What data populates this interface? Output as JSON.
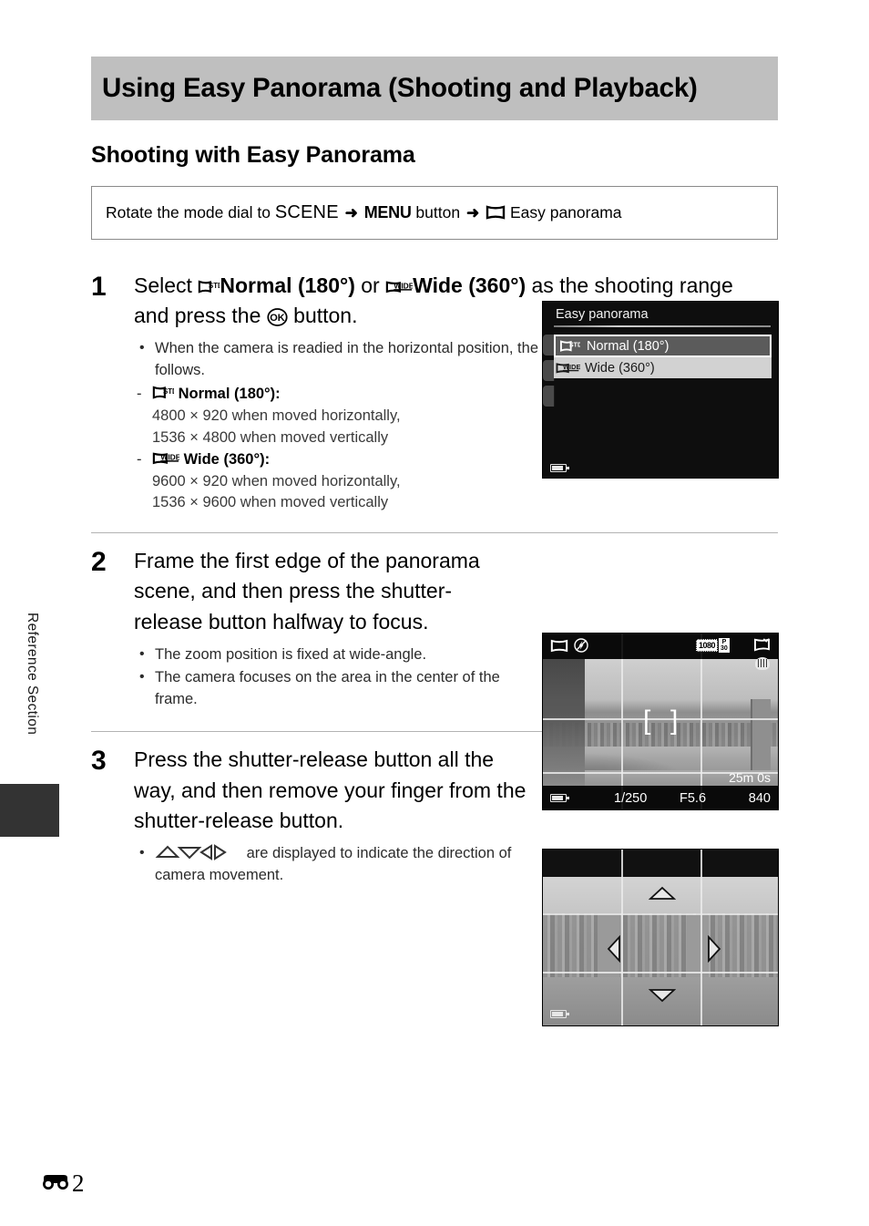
{
  "page": {
    "side_label": "Reference Section",
    "folio_number": "2",
    "folio_symbol": "reference-section-mark"
  },
  "header": {
    "title": "Using Easy Panorama (Shooting and Playback)",
    "subtitle": "Shooting with Easy Panorama"
  },
  "command_box": {
    "prefix": "Rotate the mode dial to",
    "dial": "SCENE",
    "arrow1": "➜",
    "button": "MENU",
    "button_word": "button",
    "arrow2": "➜",
    "menu_icon": "easy-panorama-icon",
    "menu_item": "Easy panorama"
  },
  "steps": [
    {
      "number": "1",
      "heading_parts": {
        "t1": "Select ",
        "icon1": "panorama-std-icon",
        "b1": "Normal (180°)",
        "t2": " or ",
        "icon2": "panorama-wide-icon",
        "b2": "Wide (360°)",
        "t3": " as the shooting range and press the ",
        "icon3": "ok-button-icon",
        "t4": " button."
      },
      "bullets": [
        "When the camera is readied in the horizontal position, the image size (width × height) is as follows."
      ],
      "subbullets": [
        {
          "icon": "panorama-std-icon",
          "label": "Normal (180°)",
          "lines": [
            "4800 × 920 when moved horizontally,",
            "1536 × 4800 when moved vertically"
          ]
        },
        {
          "icon": "panorama-wide-icon",
          "label": "Wide (360°)",
          "lines": [
            "9600 × 920 when moved horizontally,",
            "1536 × 9600 when moved vertically"
          ]
        }
      ]
    },
    {
      "number": "2",
      "heading": "Frame the first edge of the panorama scene, and then press the shutter-release button halfway to focus.",
      "bullets": [
        "The zoom position is fixed at wide-angle.",
        "The camera focuses on the area in the center of the frame."
      ]
    },
    {
      "number": "3",
      "heading": "Press the shutter-release button all the way, and then remove your finger from the shutter-release button.",
      "bullets_icon_prefix": "direction-arrows-icon",
      "bullets": [
        "are displayed to indicate the direction of camera movement."
      ]
    }
  ],
  "figures": {
    "menu_screen": {
      "title": "Easy panorama",
      "rows": [
        {
          "icon": "panorama-std-icon",
          "label": "Normal (180°)",
          "state": "selected"
        },
        {
          "icon": "panorama-wide-icon",
          "label": "Wide (360°)",
          "state": "normal"
        }
      ],
      "battery": "battery-icon"
    },
    "live_view": {
      "top_left_icons": [
        "easy-panorama-icon",
        "flash-off-icon"
      ],
      "top_right_icons": [
        "movie-1080-p30-icon",
        "panorama-scene-icon",
        "vibration-reduction-icon"
      ],
      "movie_size": "1080",
      "movie_rate": "P 30",
      "af_brackets": "af-area-brackets",
      "record_time": "25m 0s",
      "shutter_speed": "1/250",
      "aperture": "F5.6",
      "shots_remaining": "840",
      "battery": "battery-icon"
    },
    "panning_screen": {
      "arrows": [
        "up-arrow",
        "down-arrow",
        "left-arrow",
        "right-arrow"
      ],
      "battery": "battery-icon"
    }
  },
  "colors": {
    "banner_bg": "#bfbfbf",
    "tab_bg": "#333333",
    "rule": "#b3b3b3",
    "screen_bg": "#0e0e0e",
    "menu_selected_bg": "#5b5b5b",
    "menu_alt_bg": "#d2d2d2"
  }
}
